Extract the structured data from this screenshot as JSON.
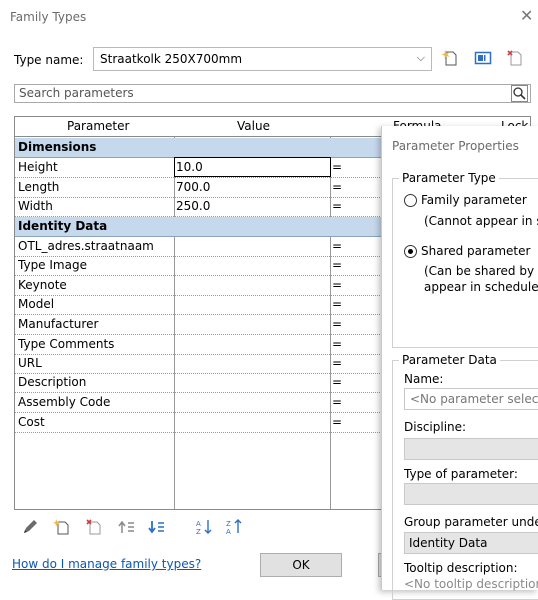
{
  "window": {
    "title": "Family Types",
    "close": "✕"
  },
  "type_name": {
    "label": "Type name:",
    "value": "Straatkolk 250X700mm",
    "chevron": "⌵"
  },
  "search": {
    "placeholder": "Search parameters"
  },
  "grid": {
    "headers": [
      "Parameter",
      "Value",
      "Formula",
      "Lock"
    ],
    "equals": "=",
    "groups": [
      {
        "name": "Dimensions",
        "rows": [
          {
            "param": "Height",
            "value": "10.0"
          },
          {
            "param": "Length",
            "value": "700.0"
          },
          {
            "param": "Width",
            "value": "250.0"
          }
        ]
      },
      {
        "name": "Identity Data",
        "rows": [
          {
            "param": "OTL_adres.straatnaam",
            "value": ""
          },
          {
            "param": "Type Image",
            "value": ""
          },
          {
            "param": "Keynote",
            "value": ""
          },
          {
            "param": "Model",
            "value": ""
          },
          {
            "param": "Manufacturer",
            "value": ""
          },
          {
            "param": "Type Comments",
            "value": ""
          },
          {
            "param": "URL",
            "value": ""
          },
          {
            "param": "Description",
            "value": ""
          },
          {
            "param": "Assembly Code",
            "value": ""
          },
          {
            "param": "Cost",
            "value": ""
          }
        ]
      }
    ]
  },
  "footer": {
    "help_link": "How do I manage family types?",
    "ok": "OK"
  },
  "parameter_properties": {
    "title": "Parameter Properties",
    "type_legend": "Parameter Type",
    "family_param": "Family parameter",
    "family_note": "(Cannot appear in sch",
    "shared_param": "Shared parameter",
    "shared_note_1": "(Can be shared by mu",
    "shared_note_2": "appear in schedules ar",
    "data_legend": "Parameter Data",
    "name_label": "Name:",
    "name_placeholder": "<No parameter selected",
    "discipline_label": "Discipline:",
    "type_label": "Type of parameter:",
    "group_label": "Group parameter under:",
    "group_value": "Identity Data",
    "tooltip_label": "Tooltip description:",
    "tooltip_value": "<No tooltip description. E"
  },
  "colors": {
    "group_bg": "#c6d8ec",
    "link": "#0b57b4",
    "icon_yellow": "#e8b84a",
    "icon_red": "#d23b3b",
    "icon_blue": "#2d6fc4"
  }
}
